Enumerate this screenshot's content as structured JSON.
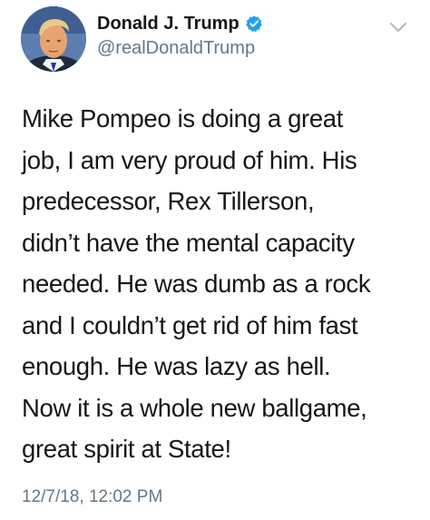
{
  "author": {
    "display_name": "Donald J. Trump",
    "handle": "@realDonaldTrump",
    "verified": true,
    "avatar_icon": "profile-photo"
  },
  "tweet": {
    "lines": [
      "Mike Pompeo is doing a great",
      "job, I am very proud of him. His",
      "predecessor, Rex Tillerson,",
      "didn’t have the mental capacity",
      "needed. He was dumb as a rock",
      "and I couldn’t get rid of him fast",
      "enough. He was lazy as hell.",
      "Now it is a whole new ballgame,",
      "great spirit at State!"
    ],
    "timestamp": "12/7/18, 12:02 PM"
  },
  "icons": {
    "verified": "verified-badge-icon",
    "menu": "chevron-down-icon"
  },
  "colors": {
    "text": "#14171a",
    "secondary": "#657786",
    "verified_blue": "#1da1f2",
    "chevron": "#aab8c2"
  }
}
